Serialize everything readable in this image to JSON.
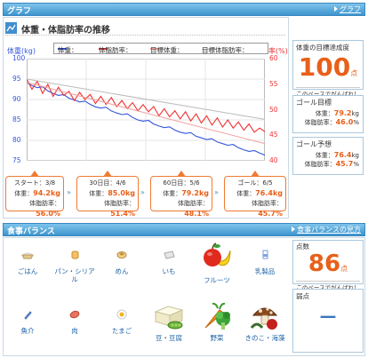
{
  "graph_header": {
    "title": "グラフ",
    "link": "グラフ"
  },
  "chart_title": "体重・体脂肪率の推移",
  "chart_data": {
    "type": "line",
    "ylabel_left": "体重(kg)",
    "ylabel_right": "体脂肪率(%)",
    "ylim_left": [
      75,
      100
    ],
    "ylim_right": [
      40,
      60
    ],
    "yticks_left": [
      "100",
      "95",
      "90",
      "85",
      "80",
      "75"
    ],
    "yticks_right": [
      "60",
      "55",
      "50",
      "45",
      "40"
    ],
    "legend": [
      "体重：",
      "体脂肪率：",
      "目標体重：",
      "目標体脂肪率："
    ],
    "series": [
      {
        "name": "体重",
        "axis": "left",
        "color": "#3355dd",
        "values": [
          94.2,
          93.4,
          92.9,
          93.1,
          92.1,
          91.5,
          91.0,
          91.2,
          90.3,
          89.9,
          89.4,
          89.6,
          88.8,
          88.2,
          87.9,
          88.1,
          87.2,
          86.7,
          86.3,
          86.5,
          85.6,
          85.0,
          84.7,
          84.9,
          84.0,
          83.5,
          83.1,
          83.3,
          82.5,
          82.0,
          81.7,
          81.9,
          81.0,
          80.6,
          80.2,
          80.4,
          79.6,
          79.2,
          78.8,
          79.0,
          78.2,
          77.7,
          77.3,
          77.5,
          76.9,
          76.4
        ]
      },
      {
        "name": "体脂肪率",
        "axis": "right",
        "color": "#ee3333",
        "values": [
          56.0,
          54.0,
          55.6,
          53.2,
          55.0,
          52.6,
          54.4,
          52.8,
          53.6,
          51.8,
          53.4,
          52.0,
          53.0,
          51.2,
          52.6,
          51.0,
          52.4,
          50.6,
          51.8,
          50.2,
          51.4,
          49.8,
          51.0,
          49.6,
          50.6,
          48.8,
          50.2,
          48.6,
          49.8,
          48.2,
          49.6,
          47.8,
          49.2,
          47.4,
          48.8,
          47.0,
          48.4,
          46.6,
          48.0,
          46.4,
          47.6,
          46.0,
          47.2,
          45.6,
          46.4,
          45.7
        ]
      },
      {
        "name": "目標体重",
        "axis": "left",
        "color": "#f2a0a0",
        "values": [
          94.2,
          79.2
        ]
      },
      {
        "name": "目標体脂肪率",
        "axis": "right",
        "color": "#bbbbbb",
        "values": [
          56.0,
          48.1
        ]
      }
    ]
  },
  "milestones": [
    {
      "header": "スタート：3/8",
      "weight_label": "体重：",
      "weight": "94.2kg",
      "fat_label": "体脂肪率：",
      "fat": "56.0%"
    },
    {
      "header": "30日目：4/6",
      "weight_label": "体重：",
      "weight": "85.0kg",
      "fat_label": "体脂肪率：",
      "fat": "51.4%"
    },
    {
      "header": "60日目：5/6",
      "weight_label": "体重：",
      "weight": "79.2kg",
      "fat_label": "体脂肪率：",
      "fat": "48.1%"
    },
    {
      "header": "ゴール：6/5",
      "weight_label": "体重：",
      "weight": "76.4kg",
      "fat_label": "体脂肪率：",
      "fat": "45.7%"
    }
  ],
  "achievement": {
    "label": "体重の目標達成度",
    "value": "100",
    "unit": "点",
    "note": "このペースでがんばれ！"
  },
  "goal": {
    "label": "ゴール目標",
    "weight_label": "体重：",
    "weight": "79.2",
    "weight_unit": "kg",
    "fat_label": "体脂肪率：",
    "fat": "46.0",
    "fat_unit": "%"
  },
  "forecast": {
    "label": "ゴール予想",
    "weight_label": "体重：",
    "weight": "76.4",
    "weight_unit": "kg",
    "fat_label": "体脂肪率：",
    "fat": "45.7",
    "fat_unit": "%"
  },
  "meal_header": {
    "title": "食事バランス",
    "link": "食事バランスの見方"
  },
  "foods": [
    {
      "name": "ごはん",
      "icon": "rice-bowl-icon"
    },
    {
      "name": "パン・シリアル",
      "icon": "bread-icon"
    },
    {
      "name": "めん",
      "icon": "noodles-icon"
    },
    {
      "name": "いも",
      "icon": "potato-icon"
    },
    {
      "name": "フルーツ",
      "icon": "fruits-icon"
    },
    {
      "name": "乳製品",
      "icon": "milk-icon"
    },
    {
      "name": "魚介",
      "icon": "fish-icon"
    },
    {
      "name": "肉",
      "icon": "meat-icon"
    },
    {
      "name": "たまご",
      "icon": "egg-icon"
    },
    {
      "name": "豆・豆腐",
      "icon": "tofu-beans-icon"
    },
    {
      "name": "野菜",
      "icon": "vegetables-icon"
    },
    {
      "name": "きのこ・海藻",
      "icon": "mushroom-seaweed-icon"
    }
  ],
  "score": {
    "label": "点数",
    "value": "86",
    "unit": "点",
    "note": "このペースでがんばれ！"
  },
  "weak_point": {
    "label": "弱点",
    "value": "－"
  },
  "colors": {
    "accent": "#e8601a",
    "header_blue": "#3d95cf",
    "weight_line": "#3355dd",
    "fat_line": "#ee3333"
  }
}
